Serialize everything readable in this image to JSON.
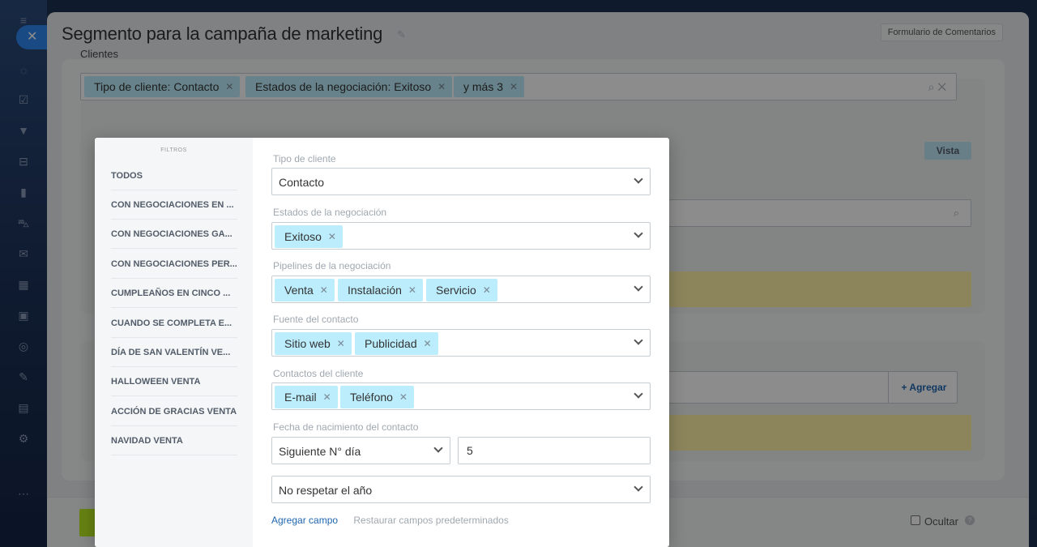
{
  "slider": {
    "title": "Segmento para la campaña de marketing",
    "feedback_label": "Formulario de Comentarios",
    "clientes_label": "Clientes",
    "vista_label": "Vista",
    "agregar_label": "+ Agregar",
    "hide_label": "Ocultar"
  },
  "filter_bar": {
    "chips": [
      {
        "label": "Tipo de cliente: Contacto"
      },
      {
        "label": "Estados de la negociación: Exitoso"
      },
      {
        "label": "y más 3"
      }
    ]
  },
  "presets": {
    "title": "FILTROS",
    "items": [
      "TODOS",
      "CON NEGOCIACIONES EN ...",
      "CON NEGOCIACIONES GA...",
      "CON NEGOCIACIONES PER...",
      "CUMPLEAÑOS EN CINCO ...",
      "CUANDO SE COMPLETA E...",
      "DÍA DE SAN VALENTÍN VE...",
      "HALLOWEEN VENTA",
      "ACCIÓN DE GRACIAS VENTA",
      "NAVIDAD VENTA"
    ]
  },
  "fields": {
    "client_type": {
      "label": "Tipo de cliente",
      "value": "Contacto"
    },
    "deal_status": {
      "label": "Estados de la negociación",
      "tags": [
        "Exitoso"
      ]
    },
    "pipelines": {
      "label": "Pipelines de la negociación",
      "tags": [
        "Venta",
        "Instalación",
        "Servicio"
      ]
    },
    "source": {
      "label": "Fuente del contacto",
      "tags": [
        "Sitio web",
        "Publicidad"
      ]
    },
    "contacts": {
      "label": "Contactos del cliente",
      "tags": [
        "E-mail",
        "Teléfono"
      ]
    },
    "birth_date": {
      "label": "Fecha de nacimiento del contacto",
      "mode": "Siguiente N° día",
      "days": "5",
      "year_option": "No respetar el año"
    }
  },
  "links": {
    "add_field": "Agregar campo",
    "restore": "Restaurar campos predeterminados"
  },
  "colors": {
    "tag_bg": "#bcedfc",
    "accent_blue": "#2f88f0",
    "green": "#bbed21",
    "yellow": "#fff2a8"
  }
}
